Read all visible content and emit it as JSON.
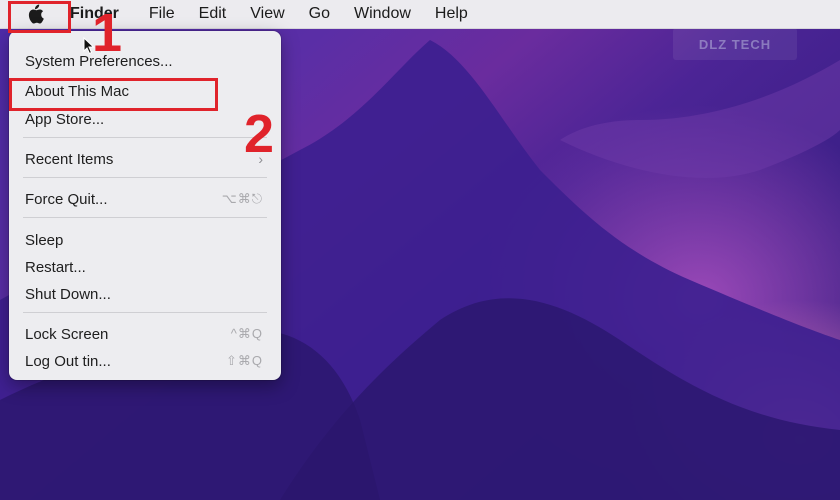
{
  "menubar": {
    "apple_icon": "apple-logo-icon",
    "items": [
      "Finder",
      "File",
      "Edit",
      "View",
      "Go",
      "Window",
      "Help"
    ]
  },
  "apple_menu": {
    "items": [
      {
        "label": "System Preferences...",
        "shortcut": ""
      },
      {
        "label": "About This Mac",
        "shortcut": ""
      },
      {
        "label": "App Store...",
        "shortcut": ""
      },
      {
        "label": "Recent Items",
        "shortcut": "",
        "submenu": true
      },
      {
        "label": "Force Quit...",
        "shortcut": "⌥⌘⎋"
      },
      {
        "label": "Sleep",
        "shortcut": ""
      },
      {
        "label": "Restart...",
        "shortcut": ""
      },
      {
        "label": "Shut Down...",
        "shortcut": ""
      },
      {
        "label": "Lock Screen",
        "shortcut": "^⌘Q"
      },
      {
        "label": "Log Out tin...",
        "shortcut": "⇧⌘Q"
      }
    ]
  },
  "annotations": {
    "step1": "1",
    "step2": "2",
    "color": "#e0232b"
  },
  "watermark": {
    "text": "DLZ TECH"
  },
  "colors": {
    "menubar_bg": "#ecebef",
    "menu_bg": "#ededf0",
    "wallpaper_base": "#3a1c8c",
    "annotation": "#e0232b"
  }
}
